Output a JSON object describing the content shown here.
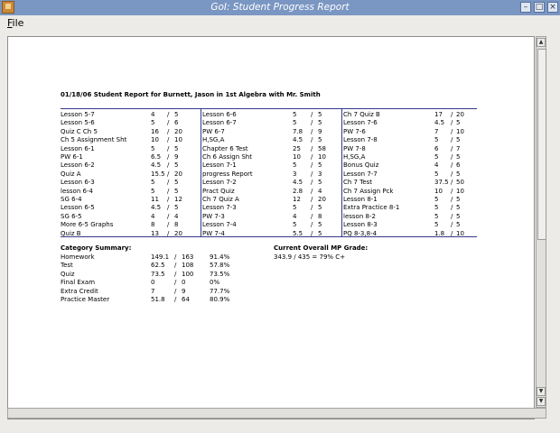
{
  "window": {
    "title": "GoI: Student Progress Report"
  },
  "menu": {
    "file_label": "File"
  },
  "report": {
    "header": "01/18/06  Student Report for Burnett, Jason in 1st Algebra with Mr. Smith",
    "columns": [
      [
        {
          "name": "Lesson 5-7",
          "earned": "4",
          "possible": "5"
        },
        {
          "name": "Lesson 5-6",
          "earned": "5",
          "possible": "6"
        },
        {
          "name": "Quiz C Ch 5",
          "earned": "16",
          "possible": "20"
        },
        {
          "name": "Ch 5 Assignment Sht",
          "earned": "10",
          "possible": "10"
        },
        {
          "name": "Lesson 6-1",
          "earned": "5",
          "possible": "5"
        },
        {
          "name": "PW 6-1",
          "earned": "6.5",
          "possible": "9"
        },
        {
          "name": "Lesson 6-2",
          "earned": "4.5",
          "possible": "5"
        },
        {
          "name": "Quiz A",
          "earned": "15.5",
          "possible": "20"
        },
        {
          "name": "Lesson 6-3",
          "earned": "5",
          "possible": "5"
        },
        {
          "name": "lesson 6-4",
          "earned": "5",
          "possible": "5"
        },
        {
          "name": "SG 6-4",
          "earned": "11",
          "possible": "12"
        },
        {
          "name": "Lesson 6-5",
          "earned": "4.5",
          "possible": "5"
        },
        {
          "name": "SG 6-5",
          "earned": "4",
          "possible": "4"
        },
        {
          "name": "More 6-5 Graphs",
          "earned": "8",
          "possible": "8"
        },
        {
          "name": "Quiz B",
          "earned": "13",
          "possible": "20"
        }
      ],
      [
        {
          "name": "Lesson 6-6",
          "earned": "5",
          "possible": "5"
        },
        {
          "name": "Lesson 6-7",
          "earned": "5",
          "possible": "5"
        },
        {
          "name": "PW 6-7",
          "earned": "7.8",
          "possible": "9"
        },
        {
          "name": "H,SG,A",
          "earned": "4.5",
          "possible": "5"
        },
        {
          "name": "Chapter 6 Test",
          "earned": "25",
          "possible": "58"
        },
        {
          "name": "Ch 6 Assign Sht",
          "earned": "10",
          "possible": "10"
        },
        {
          "name": "Lesson 7-1",
          "earned": "5",
          "possible": "5"
        },
        {
          "name": "progress Report",
          "earned": "3",
          "possible": "3"
        },
        {
          "name": "Lesson 7-2",
          "earned": "4.5",
          "possible": "5"
        },
        {
          "name": "Pract Quiz",
          "earned": "2.8",
          "possible": "4"
        },
        {
          "name": "Ch 7 Quiz A",
          "earned": "12",
          "possible": "20"
        },
        {
          "name": "Lesson 7-3",
          "earned": "5",
          "possible": "5"
        },
        {
          "name": "PW 7-3",
          "earned": "4",
          "possible": "8"
        },
        {
          "name": "Lesson 7-4",
          "earned": "5",
          "possible": "5"
        },
        {
          "name": "PW 7-4",
          "earned": "5.5",
          "possible": "5"
        }
      ],
      [
        {
          "name": "Ch 7 Quiz B",
          "earned": "17",
          "possible": "20"
        },
        {
          "name": "Lesson 7-6",
          "earned": "4.5",
          "possible": "5"
        },
        {
          "name": "PW 7-6",
          "earned": "7",
          "possible": "10"
        },
        {
          "name": "Lesson 7-8",
          "earned": "5",
          "possible": "5"
        },
        {
          "name": "PW 7-8",
          "earned": "6",
          "possible": "7"
        },
        {
          "name": "H,SG,A",
          "earned": "5",
          "possible": "5"
        },
        {
          "name": "Bonus Quiz",
          "earned": "4",
          "possible": "6"
        },
        {
          "name": "Lesson 7-7",
          "earned": "5",
          "possible": "5"
        },
        {
          "name": "Ch 7 Test",
          "earned": "37.5",
          "possible": "50"
        },
        {
          "name": "Ch 7 Assign Pck",
          "earned": "10",
          "possible": "10"
        },
        {
          "name": "Lesson 8-1",
          "earned": "5",
          "possible": "5"
        },
        {
          "name": "Extra Practice 8-1",
          "earned": "5",
          "possible": "5"
        },
        {
          "name": "lesson 8-2",
          "earned": "5",
          "possible": "5"
        },
        {
          "name": "Lesson 8-3",
          "earned": "5",
          "possible": "5"
        },
        {
          "name": "PQ 8-3,8-4",
          "earned": "1.8",
          "possible": "10"
        }
      ]
    ],
    "category_summary": {
      "heading": "Category Summary:",
      "rows": [
        {
          "category": "Homework",
          "earned": "149.1",
          "possible": "163",
          "percent": "91.4%"
        },
        {
          "category": "Test",
          "earned": "62.5",
          "possible": "108",
          "percent": "57.8%"
        },
        {
          "category": "Quiz",
          "earned": "73.5",
          "possible": "100",
          "percent": "73.5%"
        },
        {
          "category": "Final Exam",
          "earned": "0",
          "possible": "0",
          "percent": "0%"
        },
        {
          "category": "Extra Credit",
          "earned": "7",
          "possible": "9",
          "percent": "77.7%"
        },
        {
          "category": "Practice Master",
          "earned": "51.8",
          "possible": "64",
          "percent": "80.9%"
        }
      ]
    },
    "overall": {
      "heading": "Current Overall MP Grade:",
      "value": "343.9 / 435 = 79% C+"
    }
  }
}
